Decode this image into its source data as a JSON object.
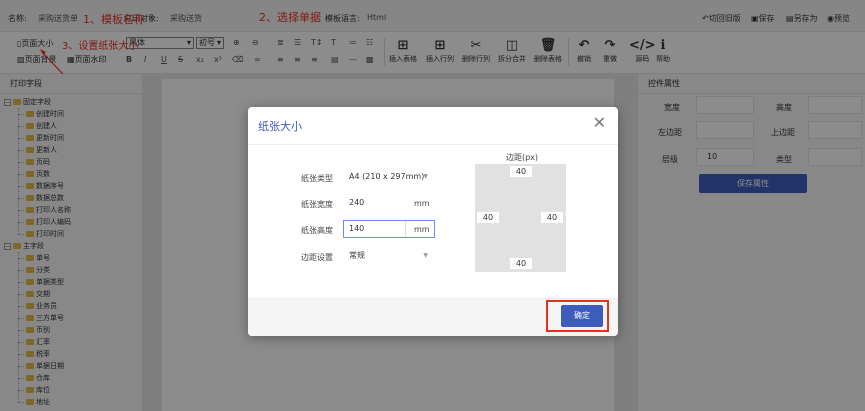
{
  "header": {
    "name_label": "名称:",
    "name_value": "采购送货单",
    "print_obj_label": "打印对象:",
    "print_obj_value": "采购送货",
    "lang_label": "模板语言:",
    "lang_value": "Html",
    "actions": [
      "切回旧版",
      "保存",
      "另存为",
      "预览"
    ]
  },
  "annotations": {
    "a1": "1、模板名称",
    "a2": "2、选择单据",
    "a3": "3、设置纸张大小"
  },
  "toolbar": {
    "page_size": "页面大小",
    "page_bg": "页面背景",
    "page_watermark": "页面水印",
    "font_family": "黑体",
    "font_size": "初号",
    "big_buttons": [
      "插入表格",
      "插入行列",
      "删除行列",
      "拆分合并",
      "删除表格",
      "撤销",
      "重做",
      "源码",
      "帮助"
    ],
    "glyphs": [
      "⊞",
      "⊞",
      "✂",
      "◫",
      "🗑",
      "↶",
      "↷",
      "</>",
      "ℹ"
    ]
  },
  "left": {
    "title": "打印字段",
    "groups": [
      {
        "label": "固定字段",
        "items": [
          "创建时间",
          "创建人",
          "更新时间",
          "更新人",
          "页码",
          "页数",
          "数据序号",
          "数据总数",
          "打印人名称",
          "打印人编码",
          "打印时间"
        ]
      },
      {
        "label": "主字段",
        "items": [
          "单号",
          "分类",
          "单据类型",
          "交期",
          "业务员",
          "三方单号",
          "币别",
          "汇率",
          "税率",
          "单据日期",
          "仓库",
          "库位",
          "地址"
        ]
      }
    ]
  },
  "right": {
    "title": "控件属性",
    "width": "宽度",
    "height": "高度",
    "left_margin": "左边距",
    "top_margin": "上边距",
    "level": "层级",
    "level_value": "10",
    "type": "类型",
    "save": "保存属性"
  },
  "dialog": {
    "title": "纸张大小",
    "paper_type_label": "纸张类型",
    "paper_type_value": "A4 (210 x 297mm)",
    "width_label": "纸张宽度",
    "width_value": "240",
    "height_label": "纸张高度",
    "height_value": "140",
    "unit": "mm",
    "margin_setting_label": "边距设置",
    "margin_setting_value": "常规",
    "margin_title": "边距(px)",
    "margin_top": "40",
    "margin_left": "40",
    "margin_right": "40",
    "margin_bottom": "40",
    "ok": "确定"
  },
  "colors": {
    "accent": "#3d5dbd",
    "annotation": "#e8321f"
  }
}
